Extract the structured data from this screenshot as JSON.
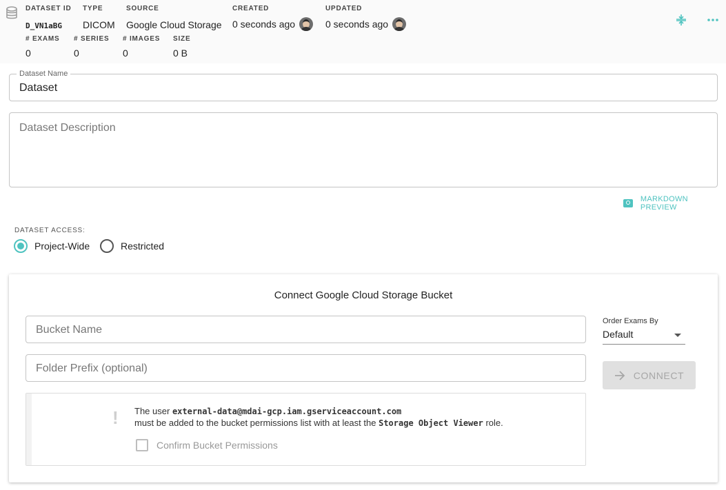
{
  "header": {
    "dataset_id": {
      "label": "DATASET ID",
      "value": "D_VN1aBG"
    },
    "type": {
      "label": "TYPE",
      "value": "DICOM"
    },
    "source": {
      "label": "SOURCE",
      "value": "Google Cloud Storage"
    },
    "created": {
      "label": "CREATED",
      "value": "0 seconds ago"
    },
    "updated": {
      "label": "UPDATED",
      "value": "0 seconds ago"
    },
    "exams": {
      "label": "# EXAMS",
      "value": "0"
    },
    "series": {
      "label": "# SERIES",
      "value": "0"
    },
    "images": {
      "label": "# IMAGES",
      "value": "0"
    },
    "size": {
      "label": "SIZE",
      "value": "0 B"
    },
    "icons": [
      "database-icon",
      "compress-icon",
      "more-horizontal-icon",
      "avatar"
    ]
  },
  "form": {
    "name_legend": "Dataset Name",
    "name_value": "Dataset",
    "description_placeholder": "Dataset Description",
    "markdown_preview": "MARKDOWN PREVIEW",
    "access_label": "DATASET ACCESS:",
    "access_options": [
      "Project-Wide",
      "Restricted"
    ],
    "access_selected": "Project-Wide"
  },
  "gcs": {
    "title": "Connect Google Cloud Storage Bucket",
    "bucket_placeholder": "Bucket Name",
    "folder_placeholder": "Folder Prefix (optional)",
    "order_label": "Order Exams By",
    "order_value": "Default",
    "connect_label": "CONNECT",
    "notice": {
      "prefix": "The user",
      "account": "external-data@mdai-gcp.iam.gserviceaccount.com",
      "line2_a": "must be added to the bucket permissions list with at least the",
      "role": "Storage Object Viewer",
      "line2_b": "role.",
      "confirm_label": "Confirm Bucket Permissions"
    }
  },
  "colors": {
    "accent": "#4fc3c0",
    "disabled_bg": "#e0e0e0"
  }
}
